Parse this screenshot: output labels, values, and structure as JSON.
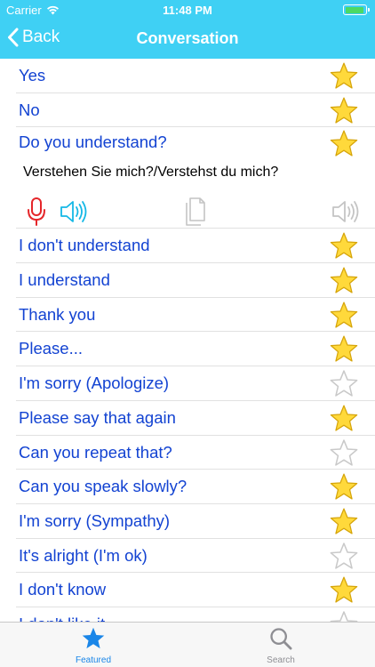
{
  "status_bar": {
    "carrier": "Carrier",
    "time": "11:48 PM"
  },
  "nav": {
    "back_label": "Back",
    "title": "Conversation"
  },
  "expanded_item": {
    "phrase": "Do you understand?",
    "translation": "Verstehen Sie mich?/Verstehst du mich?",
    "starred": true,
    "tools": [
      "microphone-icon",
      "speaker-icon",
      "copy-icon",
      "slow-speaker-icon"
    ]
  },
  "phrases": [
    {
      "text": "Yes",
      "starred": true
    },
    {
      "text": "No",
      "starred": true
    },
    {
      "text": "I don't understand",
      "starred": true
    },
    {
      "text": "I understand",
      "starred": true
    },
    {
      "text": "Thank you",
      "starred": true
    },
    {
      "text": "Please...",
      "starred": true
    },
    {
      "text": "I'm sorry (Apologize)",
      "starred": false
    },
    {
      "text": "Please say that again",
      "starred": true
    },
    {
      "text": "Can you repeat that?",
      "starred": false
    },
    {
      "text": "Can you speak slowly?",
      "starred": true
    },
    {
      "text": "I'm sorry (Sympathy)",
      "starred": true
    },
    {
      "text": "It's alright (I'm ok)",
      "starred": false
    },
    {
      "text": "I don't know",
      "starred": true
    },
    {
      "text": "I don't like it",
      "starred": false
    }
  ],
  "tabs": [
    {
      "label": "Featured",
      "icon": "star-icon",
      "active": true
    },
    {
      "label": "Search",
      "icon": "search-icon",
      "active": false
    }
  ],
  "colors": {
    "header": "#3fd0f4",
    "phrase_text": "#1343d2",
    "star_fill": "#ffd93b",
    "star_stroke": "#d6a50a",
    "tab_active": "#1a86e8",
    "tab_inactive": "#8e8e93",
    "mic": "#e5262a",
    "speaker": "#14b8e6"
  }
}
